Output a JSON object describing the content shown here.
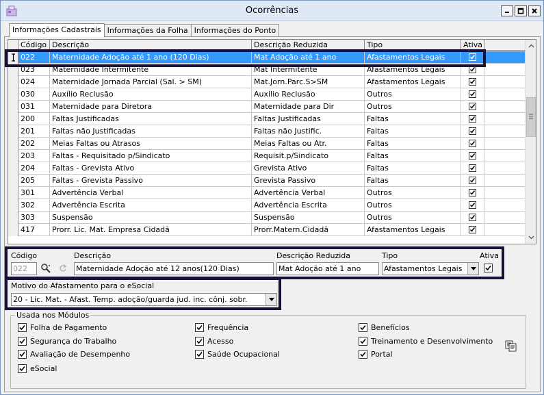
{
  "window": {
    "title": "Ocorrências"
  },
  "tabs": [
    {
      "label": "Informações Cadastrais",
      "active": true
    },
    {
      "label": "Informações da Folha",
      "active": false
    },
    {
      "label": "Informações do Ponto",
      "active": false
    }
  ],
  "grid": {
    "columns": [
      "Código",
      "Descrição",
      "Descrição Reduzida",
      "Tipo",
      "Ativa"
    ],
    "rows": [
      {
        "codigo": "022",
        "descricao": "Maternidade Adoção até 1 ano (120 Dias)",
        "reduzida": "Mat Adoção até 1 ano",
        "tipo": "Afastamentos Legais",
        "ativa": true,
        "selected": true
      },
      {
        "codigo": "023",
        "descricao": "Maternidade Intermitente",
        "reduzida": "Mat Intermitente",
        "tipo": "Afastamentos Legais",
        "ativa": true
      },
      {
        "codigo": "024",
        "descricao": "Maternidade Jornada Parcial (Sal. > SM)",
        "reduzida": "Mat.Jorn.Parc.S>SM",
        "tipo": "Afastamentos Legais",
        "ativa": true
      },
      {
        "codigo": "030",
        "descricao": "Auxílio Reclusão",
        "reduzida": "Auxílio Reclusão",
        "tipo": "Outros",
        "ativa": true
      },
      {
        "codigo": "031",
        "descricao": "Maternidade para Diretora",
        "reduzida": "Maternidade para Dir",
        "tipo": "Outros",
        "ativa": true
      },
      {
        "codigo": "200",
        "descricao": "Faltas Justificadas",
        "reduzida": "Faltas Justificadas",
        "tipo": "Faltas",
        "ativa": true
      },
      {
        "codigo": "201",
        "descricao": "Faltas não Justificadas",
        "reduzida": "Faltas não Justific.",
        "tipo": "Faltas",
        "ativa": true
      },
      {
        "codigo": "202",
        "descricao": "Meias Faltas ou Atrasos",
        "reduzida": "Meias Faltas ou Atr.",
        "tipo": "Faltas",
        "ativa": true
      },
      {
        "codigo": "203",
        "descricao": "Faltas - Requisitado p/Sindicato",
        "reduzida": "Requisit.p/Sindicato",
        "tipo": "Faltas",
        "ativa": true
      },
      {
        "codigo": "204",
        "descricao": "Faltas - Grevista Ativo",
        "reduzida": "Grevista Ativo",
        "tipo": "Faltas",
        "ativa": true
      },
      {
        "codigo": "205",
        "descricao": "Faltas - Grevista Passivo",
        "reduzida": "Grevista Passivo",
        "tipo": "Faltas",
        "ativa": true
      },
      {
        "codigo": "301",
        "descricao": "Advertência Verbal",
        "reduzida": "Advertência Verbal",
        "tipo": "Outros",
        "ativa": true
      },
      {
        "codigo": "302",
        "descricao": "Advertência Escrita",
        "reduzida": "Advertência Escrita",
        "tipo": "Outros",
        "ativa": true
      },
      {
        "codigo": "303",
        "descricao": "Suspensão",
        "reduzida": "Suspensão",
        "tipo": "Outros",
        "ativa": true
      },
      {
        "codigo": "417",
        "descricao": "Prorr. Lic. Mat. Empresa Cidadã",
        "reduzida": "Prorr.Matern.Cidadã",
        "tipo": "Afastamentos Legais",
        "ativa": true
      }
    ]
  },
  "form": {
    "codigo_label": "Código",
    "codigo_value": "022",
    "descricao_label": "Descrição",
    "descricao_value": "Maternidade Adoção até 12 anos(120 Dias)",
    "reduzida_label": "Descrição Reduzida",
    "reduzida_value": "Mat Adoção até 1 ano",
    "tipo_label": "Tipo",
    "tipo_value": "Afastamentos Legais",
    "ativa_label": "Ativa",
    "ativa_checked": true,
    "motivo_label": "Motivo do Afastamento para o eSocial",
    "motivo_value": "20 - Lic. Mat. - Afast. Temp. adoção/guarda jud. inc. cônj. sobr."
  },
  "modulos": {
    "title": "Usada nos Módulos",
    "items": [
      {
        "label": "Folha de Pagamento",
        "checked": true
      },
      {
        "label": "Segurança do Trabalho",
        "checked": true
      },
      {
        "label": "Avaliação de Desempenho",
        "checked": true
      },
      {
        "label": "eSocial",
        "checked": true
      },
      {
        "label": "Frequência",
        "checked": true
      },
      {
        "label": "Acesso",
        "checked": true
      },
      {
        "label": "Saúde Ocupacional",
        "checked": true
      },
      {
        "label": "Benefícios",
        "checked": true
      },
      {
        "label": "Treinamento e Desenvolvimento",
        "checked": true
      },
      {
        "label": "Portal",
        "checked": true
      }
    ]
  },
  "icons": {
    "app": "app-icon",
    "minimize": "minimize-icon",
    "maximize": "maximize-icon",
    "close": "close-icon",
    "search": "search-icon",
    "refresh": "refresh-icon",
    "copy": "copy-icon"
  }
}
